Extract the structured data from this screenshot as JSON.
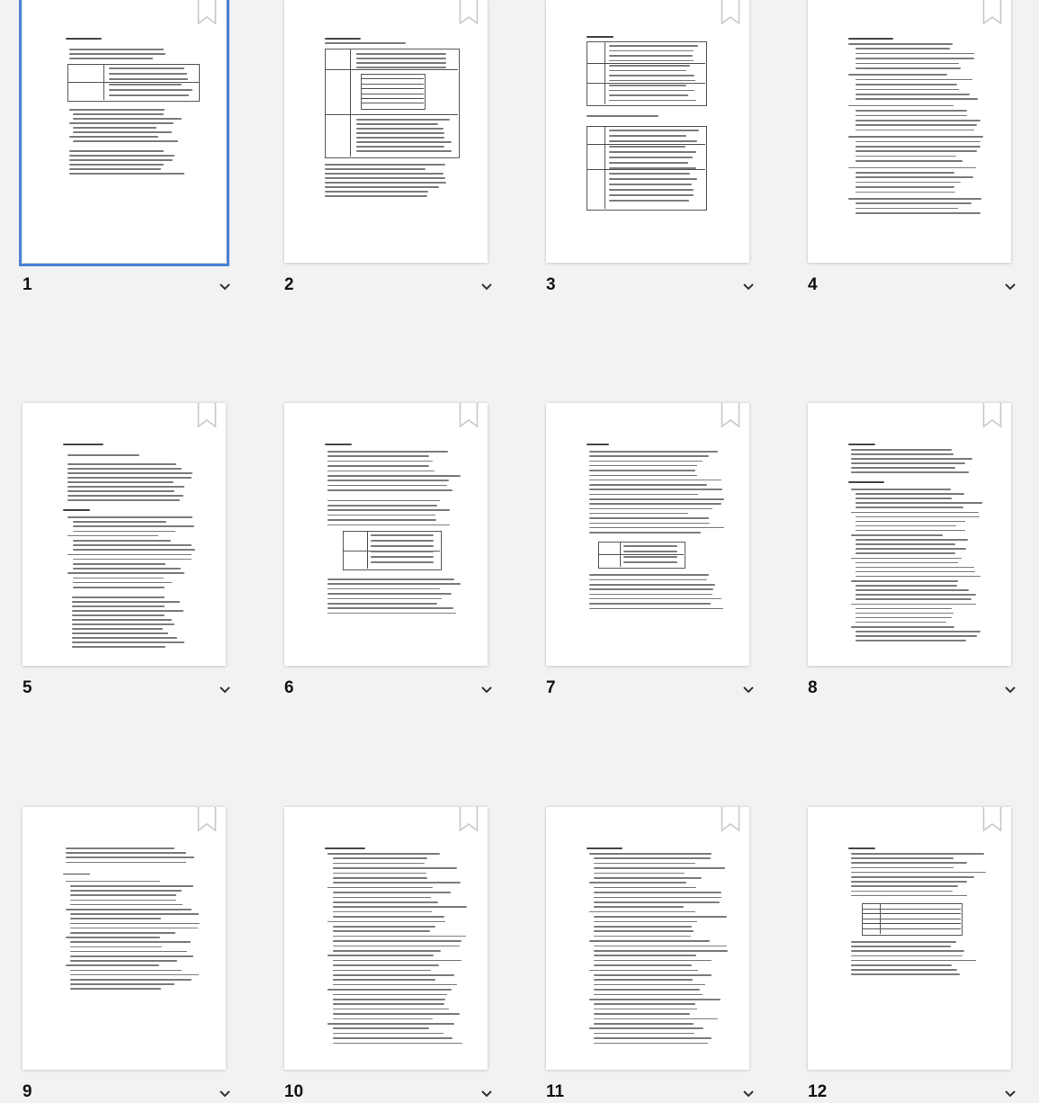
{
  "pages": [
    {
      "label": "1",
      "selected": true
    },
    {
      "label": "2",
      "selected": false
    },
    {
      "label": "3",
      "selected": false
    },
    {
      "label": "4",
      "selected": false
    },
    {
      "label": "5",
      "selected": false
    },
    {
      "label": "6",
      "selected": false
    },
    {
      "label": "7",
      "selected": false
    },
    {
      "label": "8",
      "selected": false
    },
    {
      "label": "9",
      "selected": false
    },
    {
      "label": "10",
      "selected": false
    },
    {
      "label": "11",
      "selected": false
    },
    {
      "label": "12",
      "selected": false
    }
  ],
  "icons": {
    "bookmark": "bookmark-icon",
    "menu": "chevron-down-icon"
  },
  "colors": {
    "background": "#f2f2f2",
    "page": "#ffffff",
    "selection": "#4a82d6",
    "text_lines": "#7b7b7b"
  }
}
